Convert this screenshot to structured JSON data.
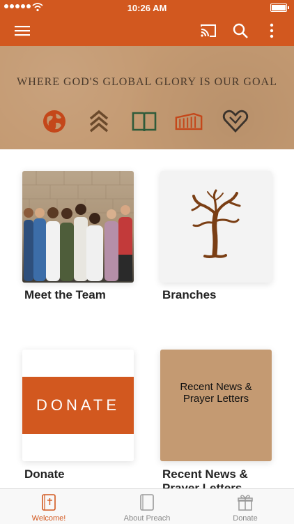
{
  "status_bar": {
    "time": "10:26 AM"
  },
  "app_bar": {
    "menu_icon": "hamburger-menu-icon",
    "cast_icon": "cast-icon",
    "search_icon": "search-icon",
    "more_icon": "more-vertical-icon",
    "color": "#d2581f"
  },
  "banner": {
    "tagline": "WHERE GOD'S GLOBAL GLORY IS OUR GOAL",
    "icons": [
      "globe-icon",
      "chevrons-up-icon",
      "open-book-icon",
      "building-icon",
      "heart-icon"
    ]
  },
  "tiles": [
    {
      "label": "Meet the Team",
      "image": "team-photo"
    },
    {
      "label": "Branches",
      "image": "tree-icon"
    },
    {
      "label": "Donate",
      "image_text": "DONATE"
    },
    {
      "label": "Recent News & Prayer Letters",
      "image_text": "Recent News & Prayer Letters"
    }
  ],
  "tab_bar": {
    "tabs": [
      {
        "label": "Welcome!",
        "icon": "bible-icon",
        "active": true
      },
      {
        "label": "About Preach",
        "icon": "book-icon",
        "active": false
      },
      {
        "label": "Donate",
        "icon": "gift-icon",
        "active": false
      }
    ]
  },
  "colors": {
    "accent": "#d2581f",
    "kraft": "#c49a72"
  }
}
